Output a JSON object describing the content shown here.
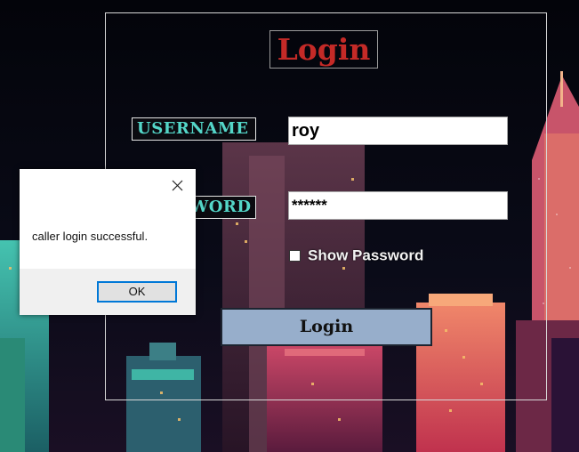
{
  "window": {
    "title": "Login"
  },
  "form": {
    "username_label": "USERNAME",
    "password_label_visible": "WORD",
    "username_value": "roy",
    "password_value": "******",
    "show_password_label": "Show Password",
    "show_password_checked": false,
    "login_button_label": "Login"
  },
  "dialog": {
    "message": "caller login successful.",
    "ok_label": "OK"
  },
  "colors": {
    "title": "#c42a27",
    "label_text": "#54d6c8",
    "login_button_bg": "#97aecb",
    "dialog_focus": "#0078d7"
  }
}
